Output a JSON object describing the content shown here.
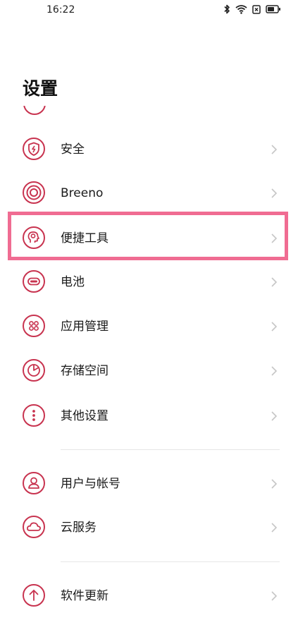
{
  "status_bar": {
    "time": "16:22",
    "icons": [
      "bluetooth-icon",
      "wifi-icon",
      "sim-card-icon",
      "battery-icon"
    ]
  },
  "page": {
    "title": "设置"
  },
  "settings_items": [
    {
      "label": "安全",
      "icon": "shield-icon"
    },
    {
      "label": "Breeno",
      "icon": "breeno-icon"
    },
    {
      "label": "便捷工具",
      "icon": "convenience-tools-icon"
    },
    {
      "label": "电池",
      "icon": "battery-icon"
    },
    {
      "label": "应用管理",
      "icon": "app-grid-icon"
    },
    {
      "label": "存储空间",
      "icon": "pie-chart-icon"
    },
    {
      "label": "其他设置",
      "icon": "more-dots-icon"
    },
    {
      "label": "用户与帐号",
      "icon": "user-icon"
    },
    {
      "label": "云服务",
      "icon": "cloud-icon"
    },
    {
      "label": "软件更新",
      "icon": "upload-arrow-icon"
    }
  ],
  "highlighted_item": "便捷工具",
  "colors": {
    "icon_accent": "#c8334f",
    "highlight_border": "#f06c92",
    "chevron": "#c6c6c6",
    "divider": "#e6e6e6"
  }
}
